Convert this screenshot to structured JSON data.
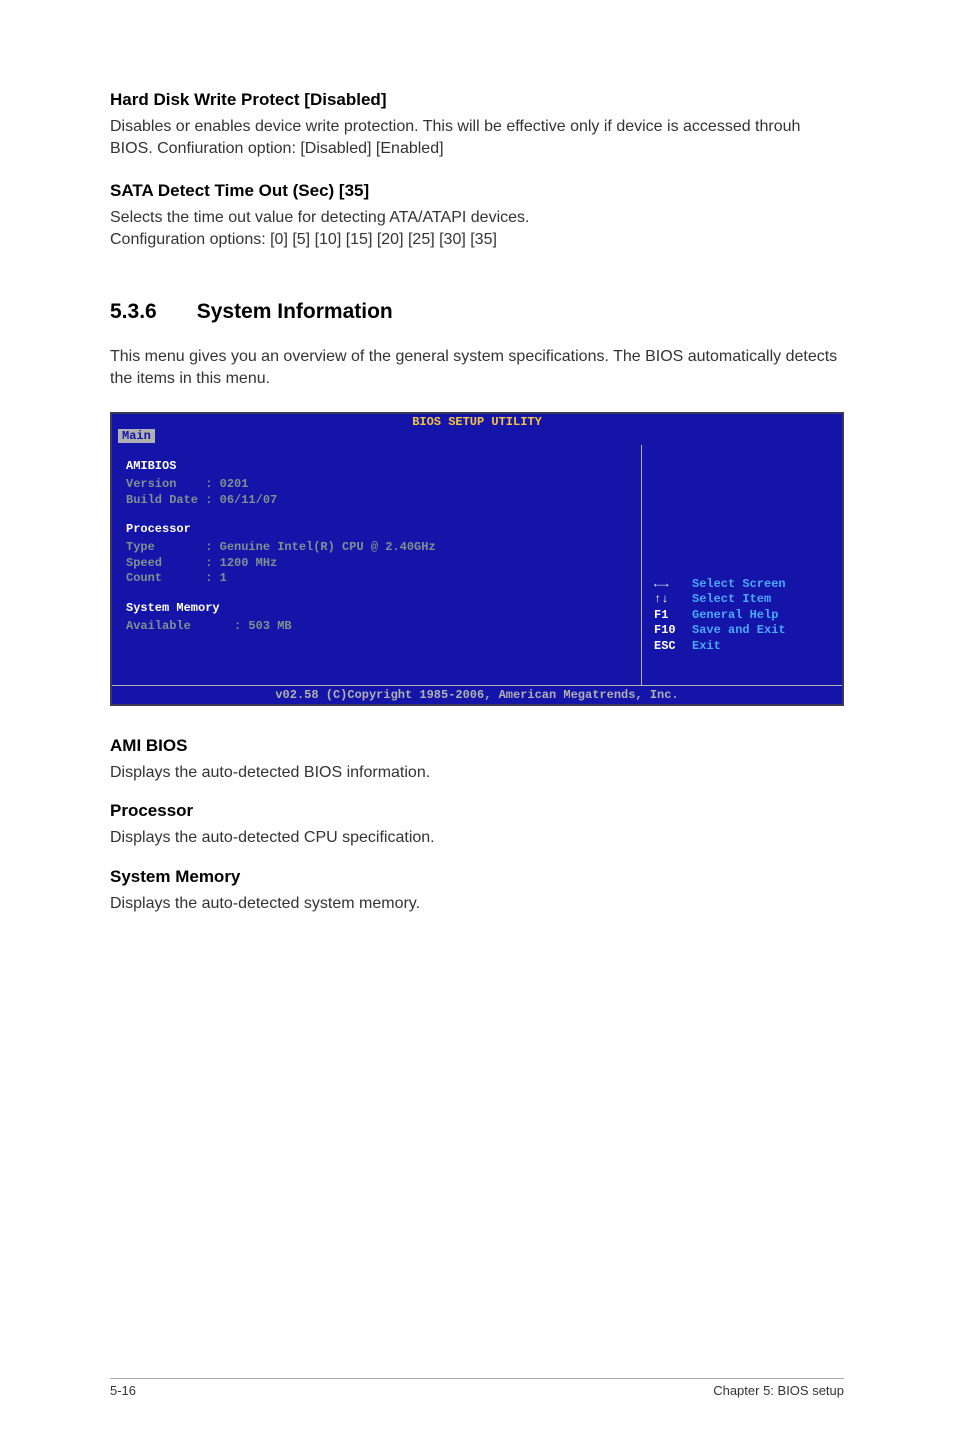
{
  "s1": {
    "heading": "Hard Disk Write Protect [Disabled]",
    "body": "Disables or enables device write protection. This will be effective only if device is accessed throuh BIOS. Confiuration option: [Disabled] [Enabled]"
  },
  "s2": {
    "heading": "SATA Detect Time Out (Sec) [35]",
    "body1": "Selects the time out value for detecting ATA/ATAPI devices.",
    "body2": "Configuration options: [0] [5] [10] [15] [20] [25] [30] [35]"
  },
  "s3": {
    "num": "5.3.6",
    "title": "System Information",
    "body": "This menu gives you an overview of the general system specifications. The BIOS automatically detects the items in this menu."
  },
  "bios": {
    "title": "BIOS SETUP UTILITY",
    "tab": "Main",
    "left": {
      "cat1": "AMIBIOS",
      "r1": "Version    : 0201",
      "r2": "Build Date : 06/11/07",
      "cat2": "Processor",
      "r3": "Type       : Genuine Intel(R) CPU @ 2.40GHz",
      "r4": "Speed      : 1200 MHz",
      "r5": "Count      : 1",
      "cat3": "System Memory",
      "r6": "Available      : 503 MB"
    },
    "right": {
      "h1_key": "←→",
      "h1_lbl": "Select Screen",
      "h2_key": "↑↓",
      "h2_lbl": "Select Item",
      "h3_key": "F1",
      "h3_lbl": "General Help",
      "h4_key": "F10",
      "h4_lbl": "Save and Exit",
      "h5_key": "ESC",
      "h5_lbl": "Exit"
    },
    "footer": "v02.58 (C)Copyright 1985-2006, American Megatrends, Inc."
  },
  "s4": {
    "heading": "AMI BIOS",
    "body": "Displays the auto-detected BIOS information."
  },
  "s5": {
    "heading": "Processor",
    "body": "Displays the auto-detected CPU specification."
  },
  "s6": {
    "heading": "System Memory",
    "body": "Displays the auto-detected system memory."
  },
  "footer": {
    "left": "5-16",
    "right": "Chapter 5: BIOS setup"
  }
}
